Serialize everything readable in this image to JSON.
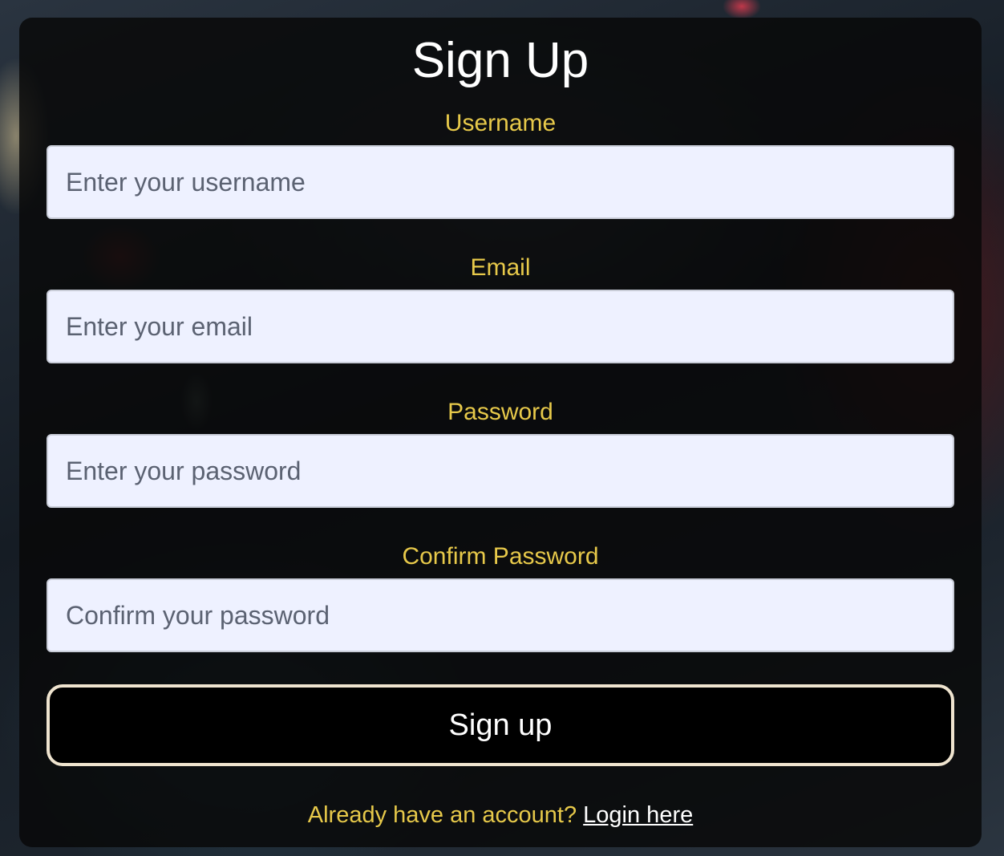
{
  "form": {
    "title": "Sign Up",
    "fields": [
      {
        "label": "Username",
        "placeholder": "Enter your username",
        "value": ""
      },
      {
        "label": "Email",
        "placeholder": "Enter your email",
        "value": ""
      },
      {
        "label": "Password",
        "placeholder": "Enter your password",
        "value": ""
      },
      {
        "label": "Confirm Password",
        "placeholder": "Confirm your password",
        "value": ""
      }
    ],
    "submit_label": "Sign up",
    "footer_text": "Already have an account?",
    "login_link": "Login here"
  },
  "colors": {
    "label_accent": "#e7c94a",
    "input_background": "#eef1ff",
    "button_background": "#000000",
    "button_border": "#efe4cf",
    "card_background": "rgba(8,8,8,0.84)"
  }
}
